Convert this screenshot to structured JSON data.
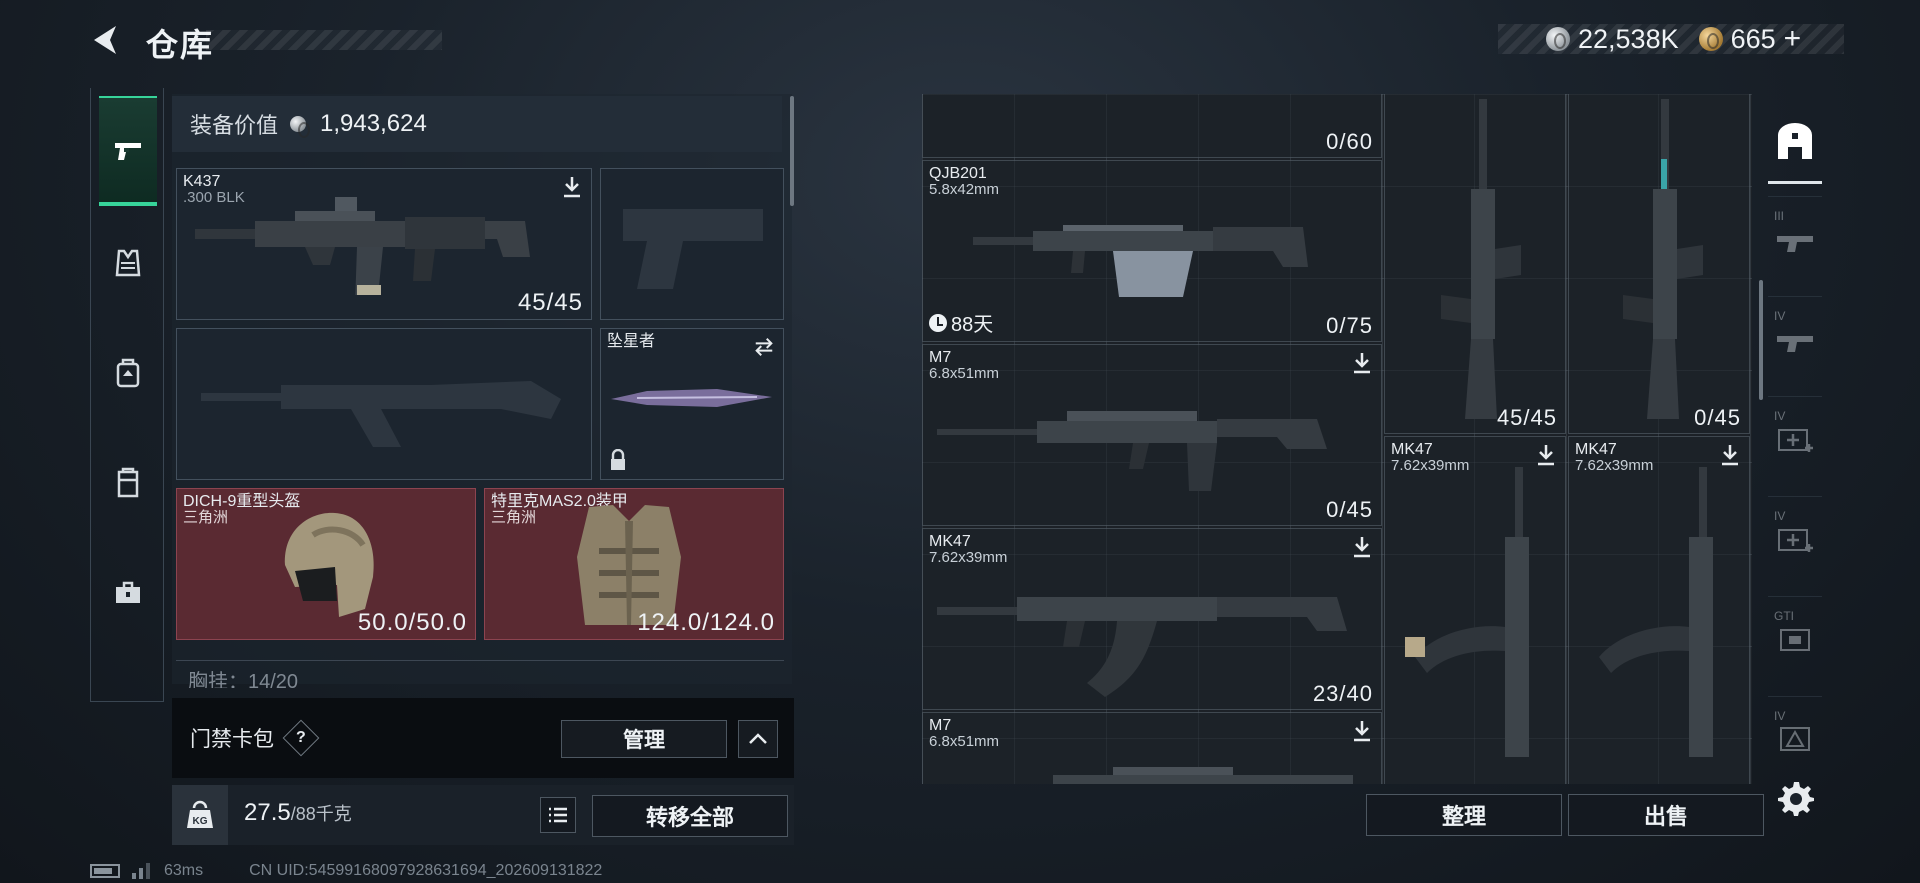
{
  "header": {
    "title": "仓库",
    "currency": {
      "silver": "22,538K",
      "gold": "665"
    }
  },
  "equipment": {
    "value_label": "装备价值",
    "value": "1,943,624",
    "primary_weapon": {
      "name": "K437",
      "caliber": ".300 BLK",
      "ammo": "45/45"
    },
    "melee": {
      "name": "坠星者"
    },
    "helmet": {
      "name": "DICH-9重型头盔",
      "origin": "三角洲",
      "durability": "50.0/50.0"
    },
    "armor": {
      "name": "特里克MAS2.0装甲",
      "origin": "三角洲",
      "durability": "124.0/124.0"
    },
    "chest_rig_partial": "胸挂：14/20"
  },
  "keycard": {
    "label": "门禁卡包",
    "help": "?",
    "manage": "管理"
  },
  "weight": {
    "current": "27.5",
    "max": "/88千克",
    "icon": "KG",
    "transfer_all": "转移全部"
  },
  "status_bar": {
    "ping": "63ms",
    "uid": "CN UID:5459916809792863169​4_202609131822"
  },
  "stash": {
    "top_item_count": "0/60",
    "items": [
      {
        "name": "QJB201",
        "caliber": "5.8x42mm",
        "timer": "88天",
        "count": "0/75"
      },
      {
        "name": "M7",
        "caliber": "6.8x51mm",
        "count": "0/45"
      },
      {
        "name": "MK47",
        "caliber": "7.62x39mm",
        "count": "23/40"
      },
      {
        "name": "M7",
        "caliber": "6.8x51mm"
      },
      {
        "name": "",
        "caliber": "",
        "count": "45/45"
      },
      {
        "name": "",
        "caliber": "",
        "count": "0/45"
      },
      {
        "name": "MK47",
        "caliber": "7.62x39mm"
      },
      {
        "name": "MK47",
        "caliber": "7.62x39mm"
      }
    ],
    "sort": "整理",
    "sell": "出售"
  },
  "filter_tabs": {
    "tiers": [
      "III",
      "IV",
      "IV",
      "IV",
      "GTI",
      "IV"
    ]
  }
}
